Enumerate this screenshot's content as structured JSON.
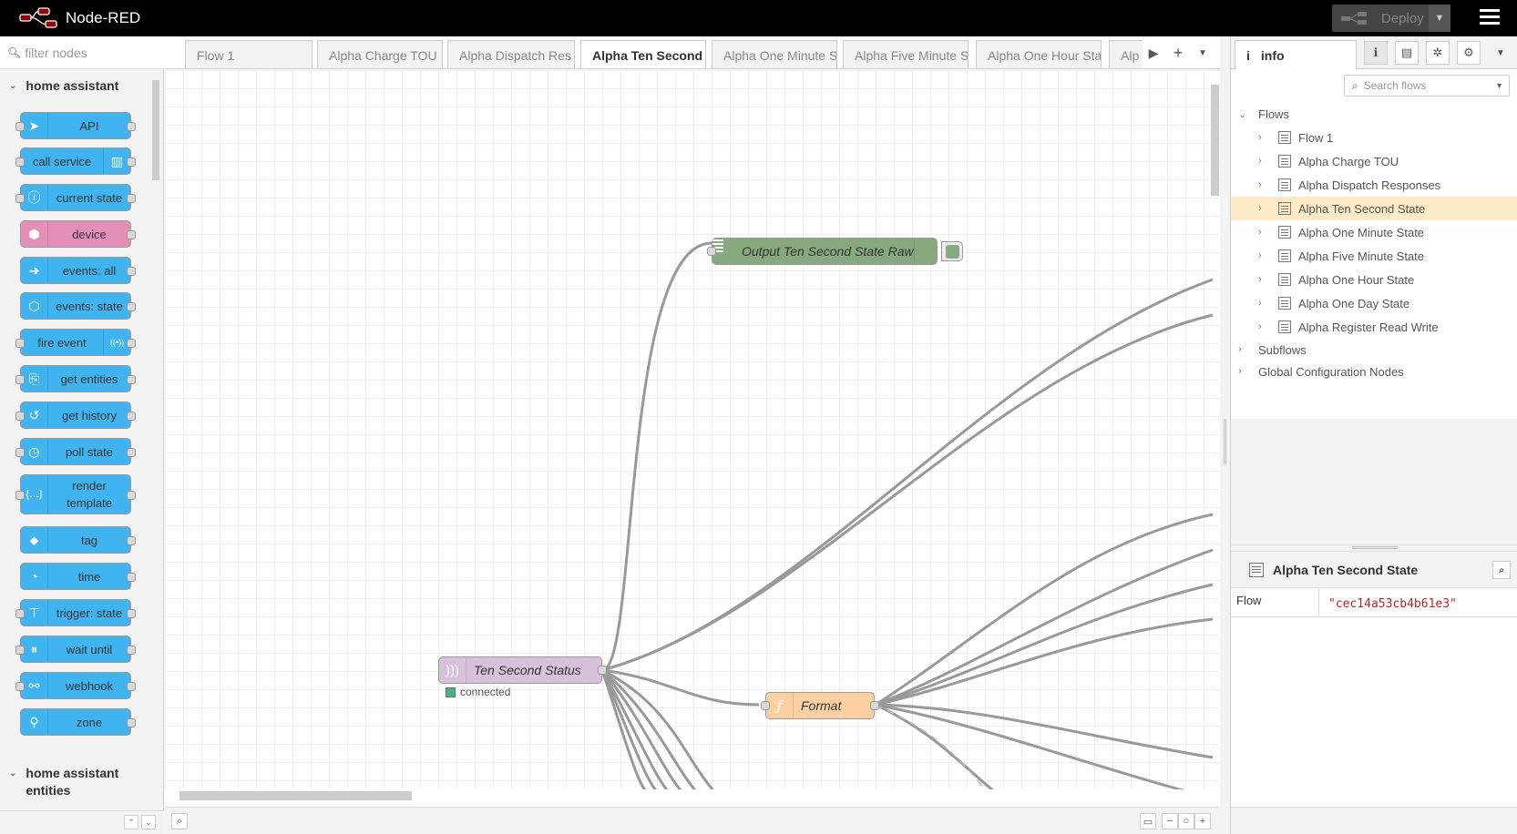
{
  "header": {
    "title": "Node-RED",
    "deploy_label": "Deploy"
  },
  "palette": {
    "filter_placeholder": "filter nodes",
    "category1": "home assistant",
    "nodes": [
      {
        "label": "API",
        "icon": "paper-plane-icon"
      },
      {
        "label": "call service",
        "icon": "router-icon"
      },
      {
        "label": "current state",
        "icon": "info-icon"
      },
      {
        "label": "device",
        "icon": "cube-icon"
      },
      {
        "label": "events: all",
        "icon": "arrow-right-icon"
      },
      {
        "label": "events: state",
        "icon": "hexagon-arrow-icon"
      },
      {
        "label": "fire event",
        "icon": "broadcast-icon"
      },
      {
        "label": "get entities",
        "icon": "search-doc-icon"
      },
      {
        "label": "get history",
        "icon": "history-icon"
      },
      {
        "label": "poll state",
        "icon": "timer-icon"
      },
      {
        "label": "render\ntemplate",
        "icon": "braces-icon"
      },
      {
        "label": "tag",
        "icon": "tag-icon"
      },
      {
        "label": "time",
        "icon": "clock-icon"
      },
      {
        "label": "trigger: state",
        "icon": "signpost-icon"
      },
      {
        "label": "wait until",
        "icon": "pause-icon"
      },
      {
        "label": "webhook",
        "icon": "webhook-icon"
      },
      {
        "label": "zone",
        "icon": "map-pin-icon"
      }
    ],
    "category2_line1": "home assistant",
    "category2_line2": "entities"
  },
  "workspace": {
    "tabs": [
      "Flow 1",
      "Alpha Charge TOU",
      "Alpha Dispatch Res",
      "Alpha Ten Second",
      "Alpha One Minute S",
      "Alpha Five Minute S",
      "Alpha One Hour Sta",
      "Alp"
    ],
    "active_tab_index": 3,
    "nodes": {
      "output": "Output Ten Second State Raw",
      "input": "Ten Second Status",
      "input_status": "connected",
      "format": "Format"
    },
    "colors": {
      "debug_node": "#87a980",
      "input_node": "#d7c2dc",
      "function_node": "#fdd0a2",
      "palette_node": "#40b4f0",
      "device_node": "#e48fb8"
    }
  },
  "sidebar": {
    "tab_label": "info",
    "search_placeholder": "Search flows",
    "flows_label": "Flows",
    "flows": [
      "Flow 1",
      "Alpha Charge TOU",
      "Alpha Dispatch Responses",
      "Alpha Ten Second State",
      "Alpha One Minute State",
      "Alpha Five Minute State",
      "Alpha One Hour State",
      "Alpha One Day State",
      "Alpha Register Read Write"
    ],
    "selected_flow_index": 3,
    "subflows_label": "Subflows",
    "global_config_label": "Global Configuration Nodes",
    "info_title": "Alpha Ten Second State",
    "info_key": "Flow",
    "info_value": "\"cec14a53cb4b61e3\""
  }
}
